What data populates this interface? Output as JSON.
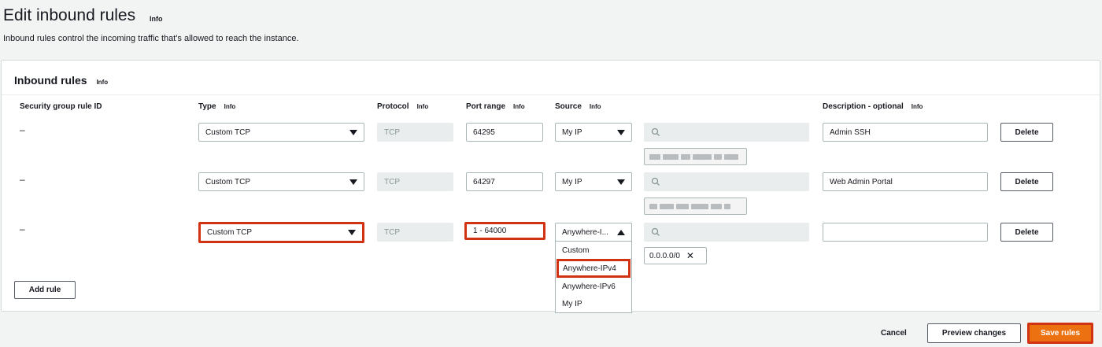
{
  "header": {
    "title": "Edit inbound rules",
    "title_info": "Info",
    "subtitle": "Inbound rules control the incoming traffic that's allowed to reach the instance."
  },
  "panel": {
    "title": "Inbound rules",
    "info": "Info"
  },
  "columns": {
    "rule_id": "Security group rule ID",
    "type": "Type",
    "type_info": "Info",
    "protocol": "Protocol",
    "protocol_info": "Info",
    "port_range": "Port range",
    "port_info": "Info",
    "source": "Source",
    "source_info": "Info",
    "description": "Description - optional",
    "description_info": "Info"
  },
  "rules": [
    {
      "id": "–",
      "type": "Custom TCP",
      "protocol": "TCP",
      "port": "64295",
      "source": "My IP",
      "description": "Admin SSH",
      "delete": "Delete"
    },
    {
      "id": "–",
      "type": "Custom TCP",
      "protocol": "TCP",
      "port": "64297",
      "source": "My IP",
      "description": "Web Admin Portal",
      "delete": "Delete"
    },
    {
      "id": "–",
      "type": "Custom TCP",
      "protocol": "TCP",
      "port": "1 - 64000",
      "source": "Anywhere-I...",
      "description": "",
      "delete": "Delete",
      "chip": "0.0.0.0/0",
      "chip_remove": "✕"
    }
  ],
  "source_dropdown": {
    "options": [
      "Custom",
      "Anywhere-IPv4",
      "Anywhere-IPv6",
      "My IP"
    ],
    "highlighted": "Anywhere-IPv4"
  },
  "add_rule": "Add rule",
  "footer": {
    "cancel": "Cancel",
    "preview": "Preview changes",
    "save": "Save rules"
  },
  "colors": {
    "highlight": "#d13212",
    "save_bg": "#ec7211"
  }
}
